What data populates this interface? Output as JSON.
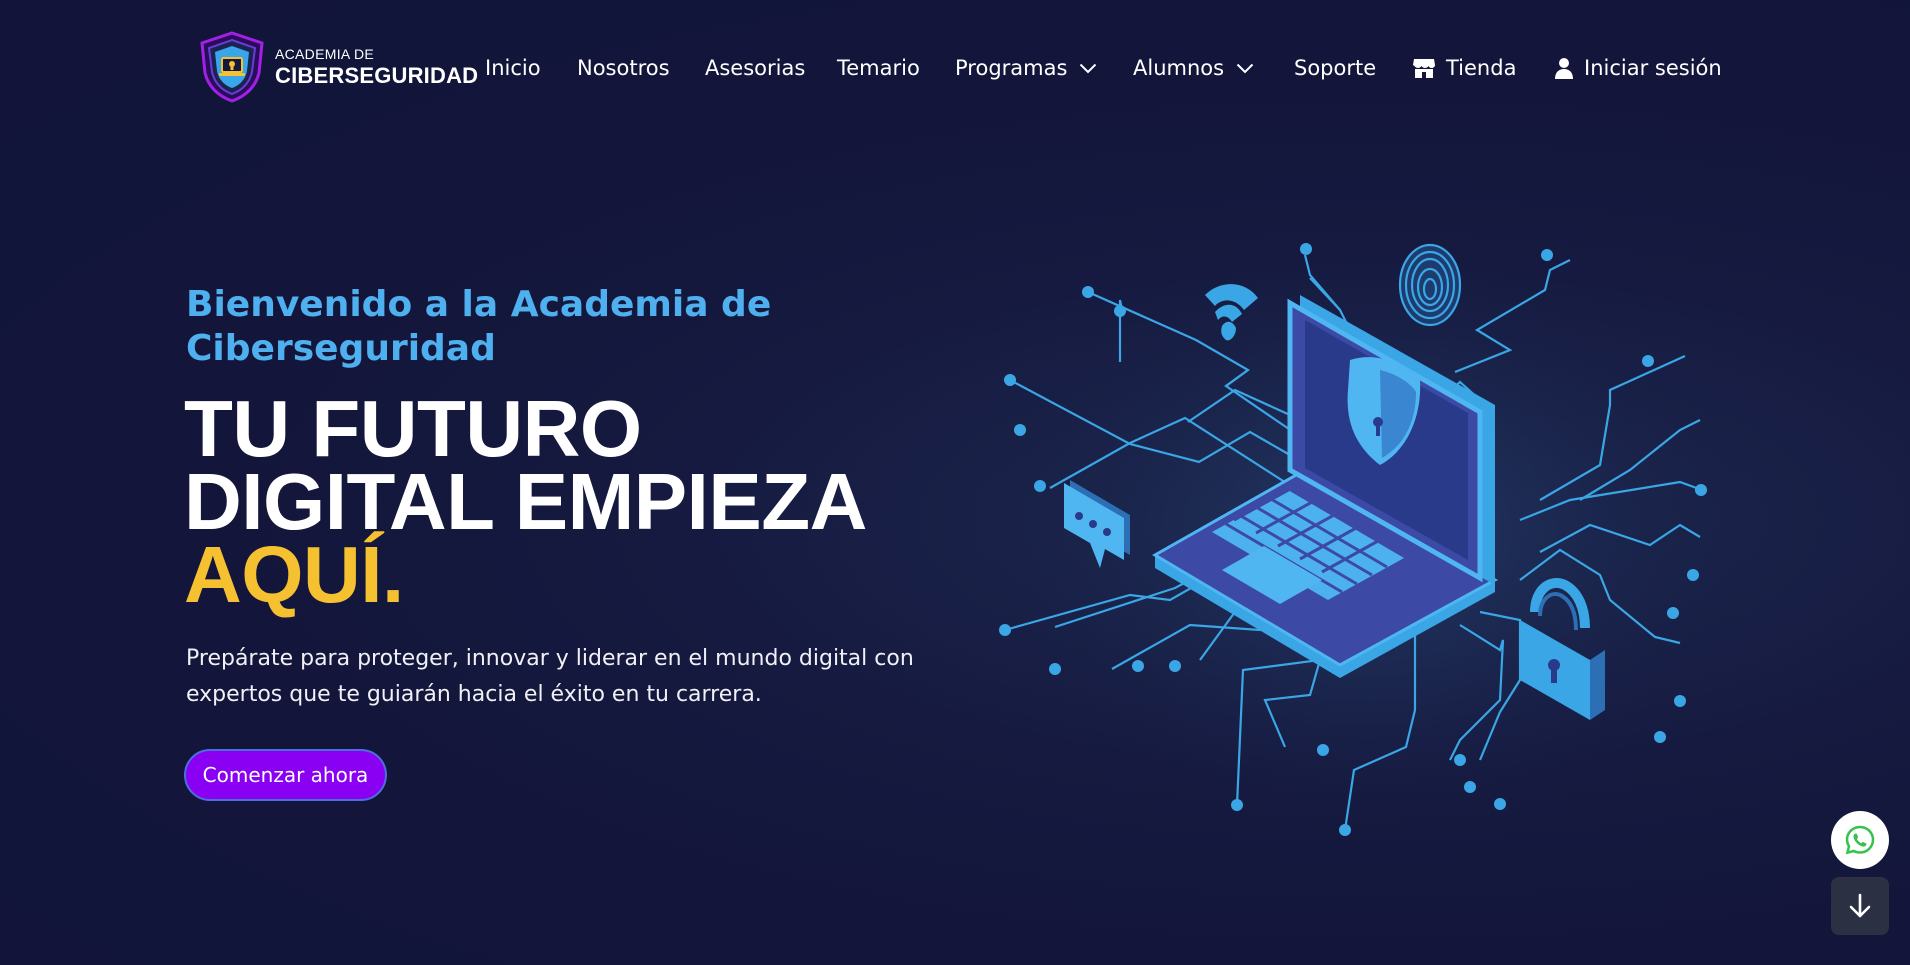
{
  "brand": {
    "line1": "ACADEMIA DE",
    "line2": "CIBERSEGURIDAD"
  },
  "nav": {
    "items": [
      {
        "label": "Inicio"
      },
      {
        "label": "Nosotros"
      },
      {
        "label": "Asesorias"
      },
      {
        "label": "Temario"
      },
      {
        "label": "Programas",
        "icon": "chevron-down-icon"
      },
      {
        "label": "Alumnos",
        "icon": "chevron-down-icon"
      },
      {
        "label": "Soporte"
      },
      {
        "label": "Tienda",
        "icon": "store-icon"
      },
      {
        "label": "Iniciar sesión",
        "icon": "user-icon"
      }
    ]
  },
  "hero": {
    "subtitle": "Bienvenido a la Academia de Ciberseguridad",
    "title_line1": "TU FUTURO",
    "title_line2": "DIGITAL EMPIEZA",
    "title_accent": "AQUÍ.",
    "description": "Prepárate para proteger, innovar y liderar en el mundo digital con expertos que te guiarán hacia el éxito en tu carrera.",
    "cta_label": "Comenzar ahora"
  },
  "floating": {
    "whatsapp_icon": "whatsapp-icon",
    "scroll_icon": "arrow-down-icon"
  },
  "colors": {
    "background": "#13163a",
    "accent_blue": "#4fb0ef",
    "accent_yellow": "#f5c130",
    "cta_purple": "#8a00f2"
  }
}
